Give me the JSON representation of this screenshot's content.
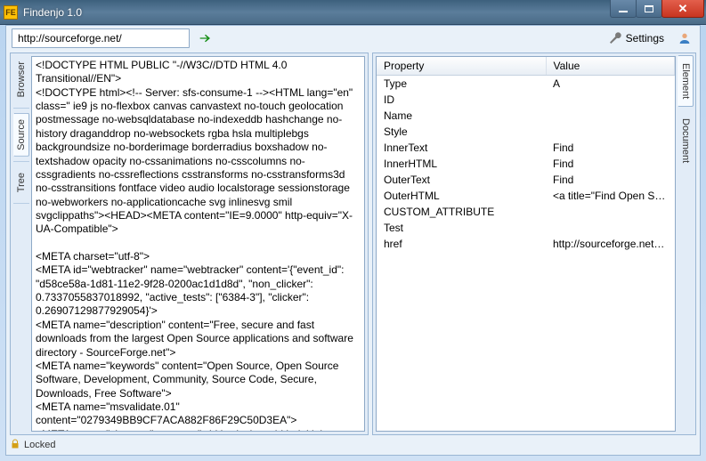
{
  "window": {
    "title": "Findenjo 1.0",
    "icon_text": "FE"
  },
  "toolbar": {
    "url": "http://sourceforge.net/",
    "settings_label": "Settings"
  },
  "left_tabs": {
    "browser": "Browser",
    "source": "Source",
    "tree": "Tree"
  },
  "right_tabs": {
    "element": "Element",
    "document": "Document"
  },
  "statusbar": {
    "locked": "Locked"
  },
  "source_html": "<!DOCTYPE HTML PUBLIC \"-//W3C//DTD HTML 4.0 Transitional//EN\">\n<!DOCTYPE html><!-- Server: sfs-consume-1 --><HTML lang=\"en\" class=\" ie9 js no-flexbox canvas canvastext no-touch geolocation postmessage no-websqldatabase no-indexeddb hashchange no-history draganddrop no-websockets rgba hsla multiplebgs backgroundsize no-borderimage borderradius boxshadow no-textshadow opacity no-cssanimations no-csscolumns no-cssgradients no-cssreflections csstransforms no-csstransforms3d no-csstransitions fontface video audio localstorage sessionstorage no-webworkers no-applicationcache svg inlinesvg smil svgclippaths\"><HEAD><META content=\"IE=9.0000\" http-equiv=\"X-UA-Compatible\">\n\n<META charset=\"utf-8\">\n<META id=\"webtracker\" name=\"webtracker\" content='{\"event_id\": \"d58ce58a-1d81-11e2-9f28-0200ac1d1d8d\", \"non_clicker\": 0.7337055837018992, \"active_tests\": [\"6384-3\"], \"clicker\": 0.26907129877929054}'>\n<META name=\"description\" content=\"Free, secure and fast downloads from the largest Open Source applications and software directory - SourceForge.net\">\n<META name=\"keywords\" content=\"Open Source, Open Source Software, Development, Community, Source Code, Secure,  Downloads, Free Software\">\n<META name=\"msvalidate.01\" content=\"0279349BB9CF7ACA882F86F29C50D3EA\">\n<META name=\"viewport\" content=\"width=device-width, initial-scale=1.0\"><TITLE>SourceForge - Download,\nDevelop and Publish Free Open Source Software</TITLE><LINK rel=\"shortcut icon\" href=\"http://a.fsdn.com/con/img/sftheme/favicon.ico\">",
  "properties": {
    "header_property": "Property",
    "header_value": "Value",
    "rows": [
      {
        "k": "Type",
        "v": "A"
      },
      {
        "k": "ID",
        "v": ""
      },
      {
        "k": "Name",
        "v": ""
      },
      {
        "k": "Style",
        "v": ""
      },
      {
        "k": "InnerText",
        "v": "Find"
      },
      {
        "k": "InnerHTML",
        "v": "Find"
      },
      {
        "k": "OuterText",
        "v": "Find"
      },
      {
        "k": "OuterHTML",
        "v": "<a title=\"Find Open Sour..."
      },
      {
        "k": "CUSTOM_ATTRIBUTE",
        "v": ""
      },
      {
        "k": "Test",
        "v": ""
      },
      {
        "k": "href",
        "v": "http://sourceforge.net/d..."
      }
    ]
  }
}
